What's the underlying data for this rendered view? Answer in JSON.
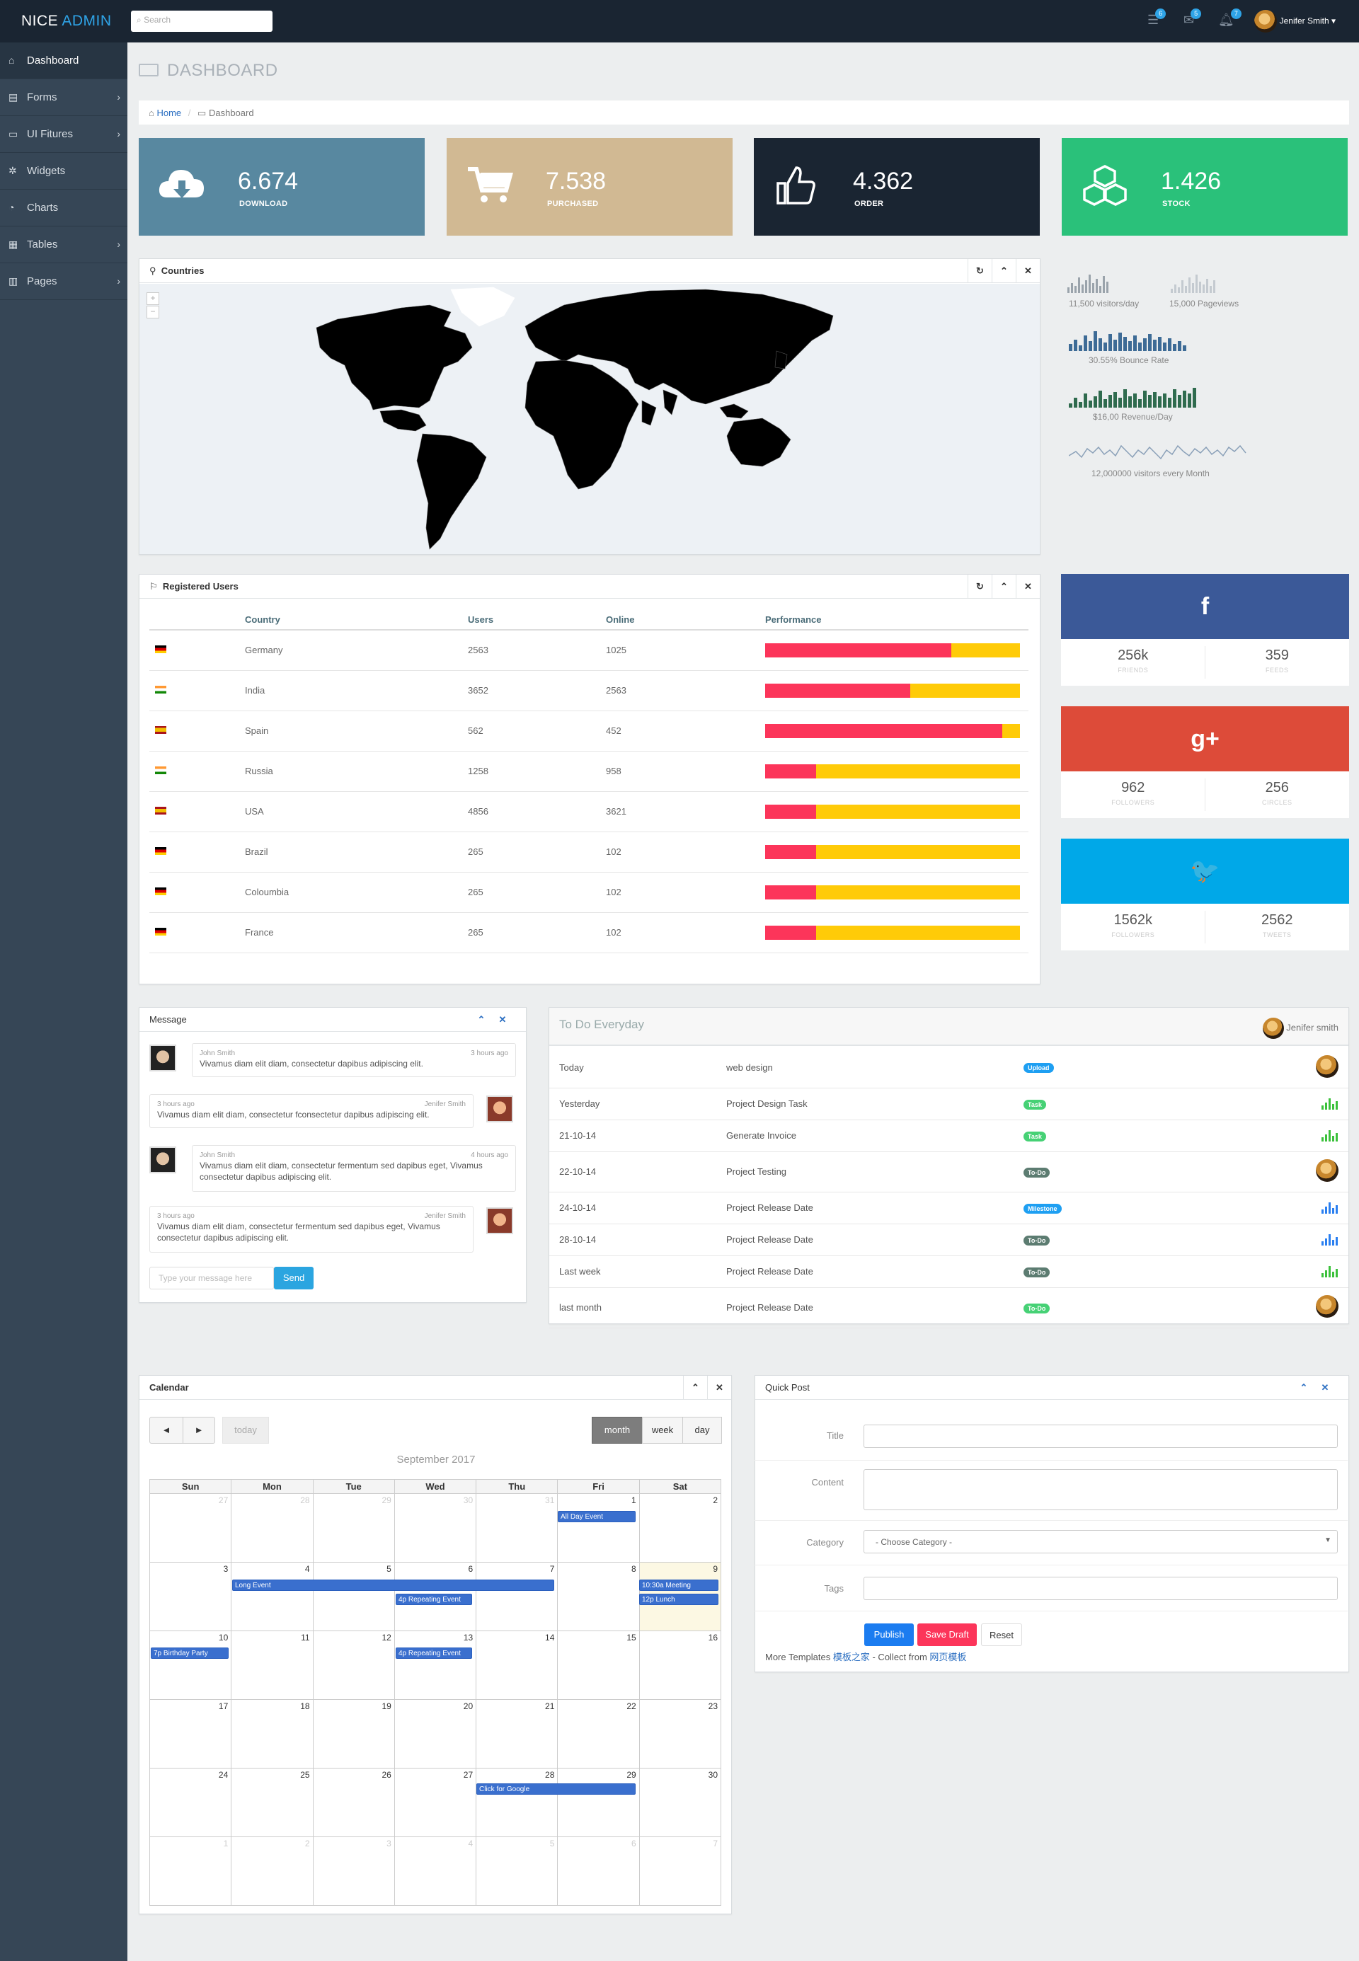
{
  "brand": {
    "nice": "NICE",
    "admin": "ADMIN"
  },
  "search": {
    "placeholder": "Search"
  },
  "top_badges": {
    "tasks": "6",
    "mail": "5",
    "notifications": "7"
  },
  "top_user": "Jenifer Smith ▾",
  "sidebar": [
    {
      "label": "Dashboard",
      "icon": "home-icon"
    },
    {
      "label": "Forms",
      "icon": "form-icon"
    },
    {
      "label": "UI Fitures",
      "icon": "ui-icon"
    },
    {
      "label": "Widgets",
      "icon": "widget-icon"
    },
    {
      "label": "Charts",
      "icon": "chart-icon"
    },
    {
      "label": "Tables",
      "icon": "table-icon"
    },
    {
      "label": "Pages",
      "icon": "page-icon"
    }
  ],
  "page_title": "DASHBOARD",
  "breadcrumb": {
    "home": "Home",
    "sep": "/",
    "current": "Dashboard"
  },
  "stats": [
    {
      "value": "6.674",
      "label": "DOWNLOAD",
      "color": "#5888a0",
      "icon": "cloud-download-icon"
    },
    {
      "value": "7.538",
      "label": "PURCHASED",
      "color": "#d1b993",
      "icon": "cart-icon"
    },
    {
      "value": "4.362",
      "label": "ORDER",
      "color": "#1a2532",
      "icon": "thumbs-up-icon"
    },
    {
      "value": "1.426",
      "label": "STOCK",
      "color": "#2ac17a",
      "icon": "cubes-icon"
    }
  ],
  "countries_panel": {
    "title": "Countries"
  },
  "sparklines": {
    "visitors_day": "11,500 visitors/day",
    "pageviews": "15,000 Pageviews",
    "bounce": "30.55% Bounce Rate",
    "revenue": "$16,00 Revenue/Day",
    "visitors_month": "12,000000 visitors every Month"
  },
  "registered_users": {
    "title": "Registered Users",
    "headers": [
      "Country",
      "Users",
      "Online",
      "Performance"
    ],
    "rows": [
      {
        "country": "Germany",
        "users": "2563",
        "online": "1025",
        "flag": "de",
        "perf": 0.73
      },
      {
        "country": "India",
        "users": "3652",
        "online": "2563",
        "flag": "in",
        "perf": 0.57
      },
      {
        "country": "Spain",
        "users": "562",
        "online": "452",
        "flag": "es",
        "perf": 0.93
      },
      {
        "country": "Russia",
        "users": "1258",
        "online": "958",
        "flag": "in",
        "perf": 0.2
      },
      {
        "country": "USA",
        "users": "4856",
        "online": "3621",
        "flag": "es",
        "perf": 0.2
      },
      {
        "country": "Brazil",
        "users": "265",
        "online": "102",
        "flag": "de",
        "perf": 0.2
      },
      {
        "country": "Coloumbia",
        "users": "265",
        "online": "102",
        "flag": "de",
        "perf": 0.2
      },
      {
        "country": "France",
        "users": "265",
        "online": "102",
        "flag": "de",
        "perf": 0.2
      }
    ]
  },
  "social": [
    {
      "network": "facebook",
      "glyph": "f",
      "color": "#3b5998",
      "a_val": "256k",
      "a_lbl": "FRIENDS",
      "b_val": "359",
      "b_lbl": "FEEDS"
    },
    {
      "network": "google-plus",
      "glyph": "g+",
      "color": "#dd4b39",
      "a_val": "962",
      "a_lbl": "FOLLOWERS",
      "b_val": "256",
      "b_lbl": "CIRCLES"
    },
    {
      "network": "twitter",
      "glyph": "🐦",
      "color": "#00a8e8",
      "a_val": "1562k",
      "a_lbl": "FOLLOWERS",
      "b_val": "2562",
      "b_lbl": "TWEETS"
    }
  ],
  "messages": {
    "title": "Message",
    "items": [
      {
        "name": "John Smith",
        "time": "3 hours ago",
        "text": "Vivamus diam elit diam, consectetur dapibus adipiscing elit.",
        "side": "left"
      },
      {
        "name": "Jenifer Smith",
        "time": "3 hours ago",
        "text": "Vivamus diam elit diam, consectetur fconsectetur dapibus adipiscing elit.",
        "side": "right"
      },
      {
        "name": "John Smith",
        "time": "4 hours ago",
        "text": "Vivamus diam elit diam, consectetur fermentum sed dapibus eget, Vivamus consectetur dapibus adipiscing elit.",
        "side": "left"
      },
      {
        "name": "Jenifer Smith",
        "time": "3 hours ago",
        "text": "Vivamus diam elit diam, consectetur fermentum sed dapibus eget, Vivamus consectetur dapibus adipiscing elit.",
        "side": "right"
      }
    ],
    "input_placeholder": "Type your message here",
    "send": "Send"
  },
  "todo": {
    "title": "To Do Everyday",
    "user": "Jenifer smith",
    "rows": [
      {
        "when": "Today",
        "task": "web design",
        "tag": "Upload",
        "tag_color": "#1e9ff2",
        "end": "avatar"
      },
      {
        "when": "Yesterday",
        "task": "Project Design Task",
        "tag": "Task",
        "tag_color": "#46d175",
        "end": "bars-green"
      },
      {
        "when": "21-10-14",
        "task": "Generate Invoice",
        "tag": "Task",
        "tag_color": "#46d175",
        "end": "bars-green"
      },
      {
        "when": "22-10-14",
        "task": "Project Testing",
        "tag": "To-Do",
        "tag_color": "#5c7c71",
        "end": "avatar"
      },
      {
        "when": "24-10-14",
        "task": "Project Release Date",
        "tag": "Milestone",
        "tag_color": "#1e9ff2",
        "end": "bars-blue"
      },
      {
        "when": "28-10-14",
        "task": "Project Release Date",
        "tag": "To-Do",
        "tag_color": "#5c7c71",
        "end": "bars-blue"
      },
      {
        "when": "Last week",
        "task": "Project Release Date",
        "tag": "To-Do",
        "tag_color": "#5c7c71",
        "end": "bars-green"
      },
      {
        "when": "last month",
        "task": "Project Release Date",
        "tag": "To-Do",
        "tag_color": "#46d175",
        "end": "avatar"
      }
    ]
  },
  "calendar": {
    "title": "Calendar",
    "month_label": "September 2017",
    "today": "today",
    "views": [
      "month",
      "week",
      "day"
    ],
    "prev": "◄",
    "next": "►",
    "weekdays": [
      "Sun",
      "Mon",
      "Tue",
      "Wed",
      "Thu",
      "Fri",
      "Sat"
    ],
    "weeks": [
      [
        {
          "d": "27",
          "o": true
        },
        {
          "d": "28",
          "o": true
        },
        {
          "d": "29",
          "o": true
        },
        {
          "d": "30",
          "o": true
        },
        {
          "d": "31",
          "o": true
        },
        {
          "d": "1"
        },
        {
          "d": "2"
        }
      ],
      [
        {
          "d": "3"
        },
        {
          "d": "4"
        },
        {
          "d": "5"
        },
        {
          "d": "6"
        },
        {
          "d": "7"
        },
        {
          "d": "8"
        },
        {
          "d": "9",
          "today": true
        }
      ],
      [
        {
          "d": "10"
        },
        {
          "d": "11"
        },
        {
          "d": "12"
        },
        {
          "d": "13"
        },
        {
          "d": "14"
        },
        {
          "d": "15"
        },
        {
          "d": "16"
        }
      ],
      [
        {
          "d": "17"
        },
        {
          "d": "18"
        },
        {
          "d": "19"
        },
        {
          "d": "20"
        },
        {
          "d": "21"
        },
        {
          "d": "22"
        },
        {
          "d": "23"
        }
      ],
      [
        {
          "d": "24"
        },
        {
          "d": "25"
        },
        {
          "d": "26"
        },
        {
          "d": "27"
        },
        {
          "d": "28"
        },
        {
          "d": "29"
        },
        {
          "d": "30"
        }
      ],
      [
        {
          "d": "1",
          "o": true
        },
        {
          "d": "2",
          "o": true
        },
        {
          "d": "3",
          "o": true
        },
        {
          "d": "4",
          "o": true
        },
        {
          "d": "5",
          "o": true
        },
        {
          "d": "6",
          "o": true
        },
        {
          "d": "7",
          "o": true
        }
      ]
    ],
    "events": {
      "all_day": "All Day Event",
      "long": "Long Event",
      "repeat1": "4p Repeating Event",
      "meeting": "10:30a Meeting",
      "lunch": "12p Lunch",
      "birthday": "7p Birthday Party",
      "repeat2": "4p Repeating Event",
      "google": "Click for Google"
    }
  },
  "quick_post": {
    "title": "Quick Post",
    "labels": {
      "title": "Title",
      "content": "Content",
      "category": "Category",
      "tags": "Tags"
    },
    "category_value": "- Choose Category -",
    "buttons": {
      "publish": "Publish",
      "draft": "Save Draft",
      "reset": "Reset"
    },
    "footer": {
      "prefix": "More Templates ",
      "link1": "模板之家",
      "mid": " - Collect from ",
      "link2": "网页模板"
    }
  }
}
